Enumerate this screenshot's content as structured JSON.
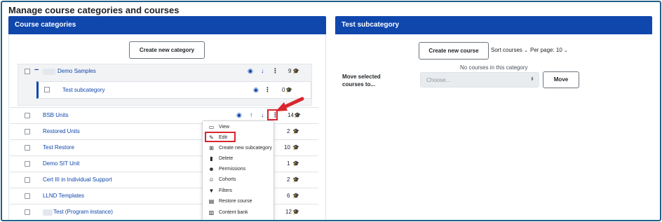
{
  "page": {
    "title": "Manage course categories and courses"
  },
  "left_panel": {
    "title": "Course categories",
    "create_button": "Create new category",
    "categories": [
      {
        "name": "Demo Samples",
        "count": "9",
        "expanded_marker": "−"
      },
      {
        "name": "Test subcategory",
        "count": "0"
      },
      {
        "name": "BSB Units",
        "count": "14"
      },
      {
        "name": "Restored Units",
        "count": "2"
      },
      {
        "name": "Test Restore",
        "count": "10"
      },
      {
        "name": "Demo SIT Unit",
        "count": "1"
      },
      {
        "name": "Cert III in Individual Support",
        "count": "2"
      },
      {
        "name": "LLND Templates",
        "count": "6"
      },
      {
        "name": "Test (Program instance)",
        "count": "12"
      }
    ]
  },
  "action_menu": {
    "items": [
      {
        "label": "View",
        "icon": "window-icon"
      },
      {
        "label": "Edit",
        "icon": "pencil-icon"
      },
      {
        "label": "Create new subcategory",
        "icon": "sitemap-icon"
      },
      {
        "label": "Delete",
        "icon": "trash-icon"
      },
      {
        "label": "Permissions",
        "icon": "users-cog-icon"
      },
      {
        "label": "Cohorts",
        "icon": "users-icon"
      },
      {
        "label": "Filters",
        "icon": "filter-icon"
      },
      {
        "label": "Restore course",
        "icon": "archive-icon"
      },
      {
        "label": "Content bank",
        "icon": "server-icon"
      }
    ]
  },
  "right_panel": {
    "title": "Test subcategory",
    "create_button": "Create new course",
    "sort_label": "Sort courses",
    "per_page_label": "Per page: 10",
    "empty_message": "No courses in this category",
    "move_label_line1": "Move selected",
    "move_label_line2": "courses to...",
    "select_placeholder": "Choose...",
    "move_button": "Move"
  },
  "colors": {
    "header": "#0f47ad",
    "link": "#0f47ad",
    "annotation": "#d9262e",
    "frame": "#1f5f86"
  }
}
